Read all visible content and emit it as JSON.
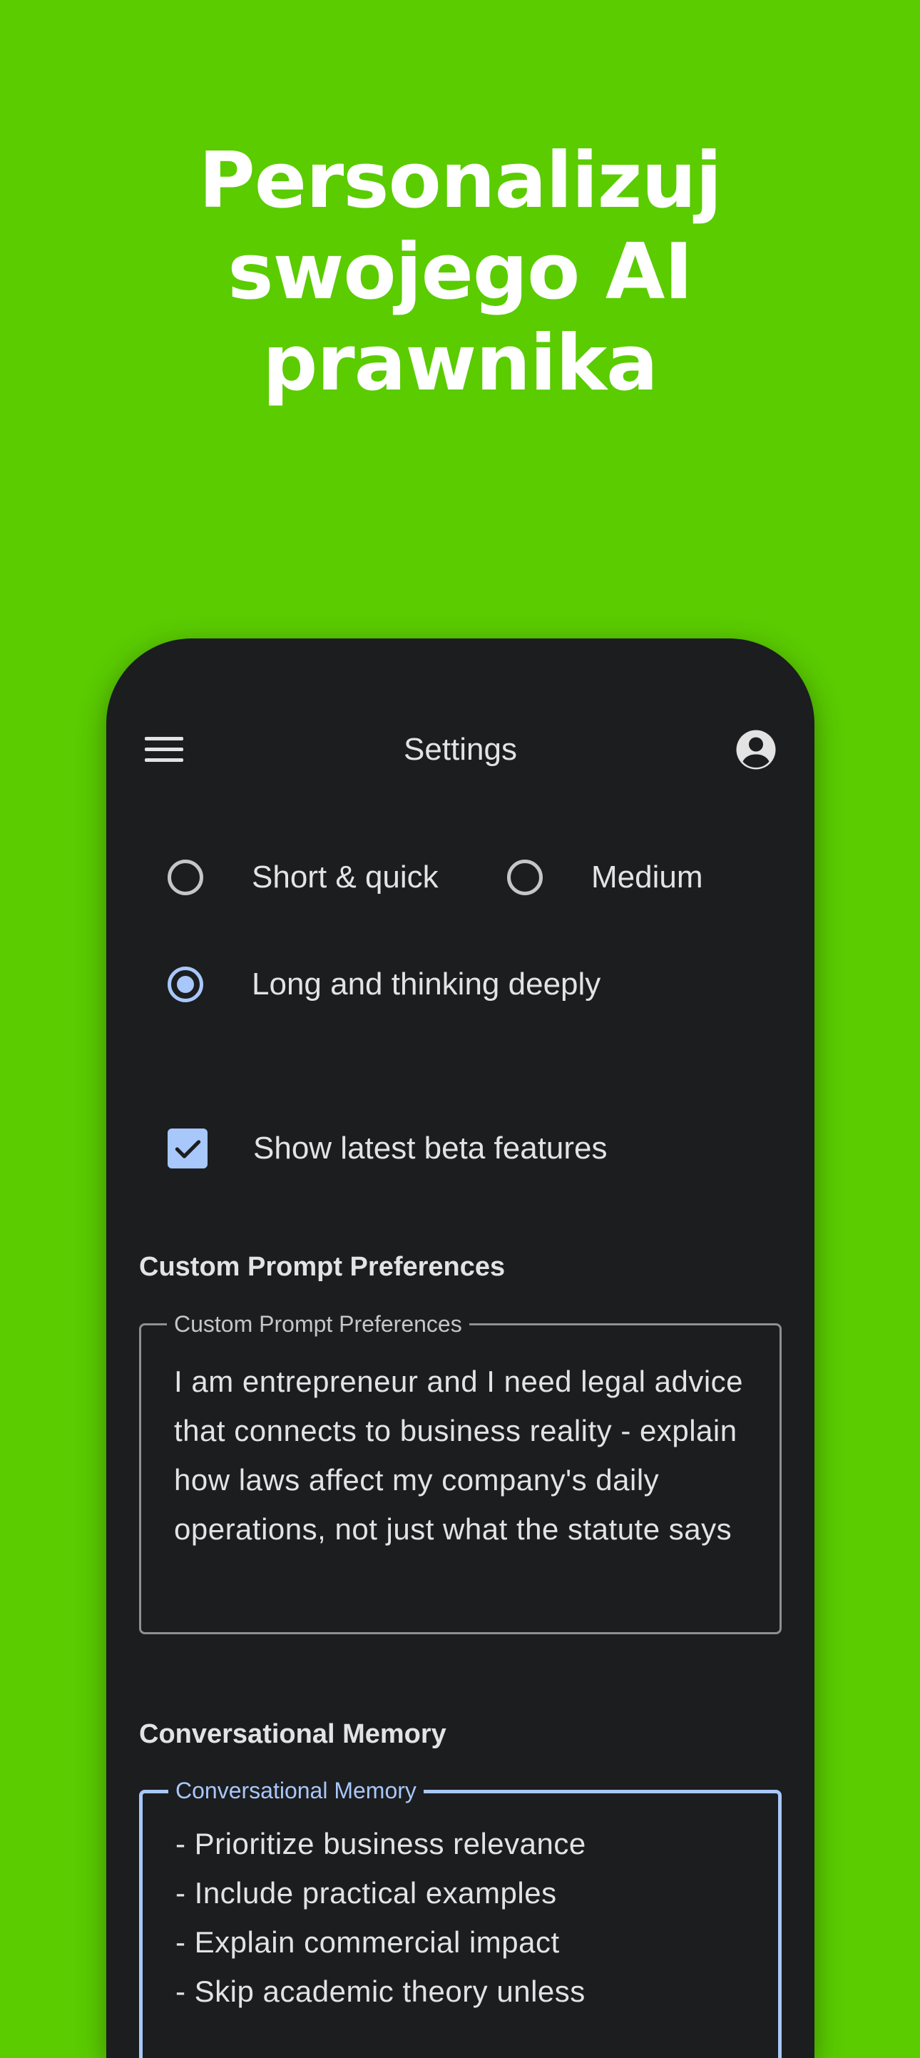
{
  "headline": {
    "line1": "Personalizuj",
    "line2": "swojego AI",
    "line3": "prawnika"
  },
  "appbar": {
    "title": "Settings",
    "menu_icon": "menu-icon",
    "account_icon": "account-circle-icon"
  },
  "response_length": {
    "options": [
      {
        "label": "Short & quick",
        "checked": false
      },
      {
        "label": "Medium",
        "checked": false
      },
      {
        "label": "Long and thinking deeply",
        "checked": true
      }
    ]
  },
  "beta": {
    "label": "Show latest beta features",
    "checked": true
  },
  "custom_prompt": {
    "section_title": "Custom Prompt Preferences",
    "field_label": "Custom Prompt Preferences",
    "value": "I am entrepreneur and I  need legal advice that connects to business reality - explain how laws affect my company's daily operations, not just what the statute says"
  },
  "memory": {
    "section_title": "Conversational Memory",
    "field_label": "Conversational Memory",
    "lines": [
      "- Prioritize business relevance",
      "- Include practical examples",
      "- Explain commercial impact",
      "- Skip academic theory unless"
    ]
  },
  "colors": {
    "background": "#5ACC00",
    "surface": "#1C1D1F",
    "accent": "#A8C7FA",
    "text": "#E3E3E3"
  }
}
